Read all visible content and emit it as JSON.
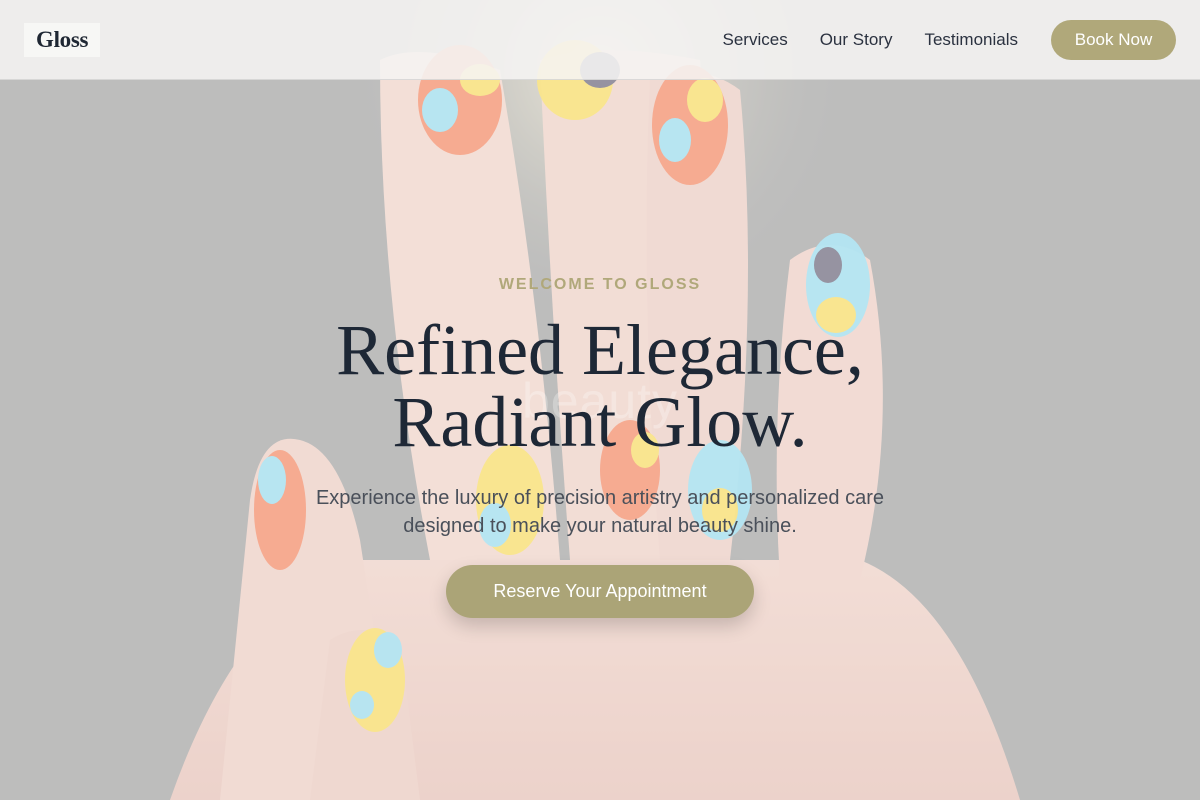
{
  "brand": {
    "name": "Gloss"
  },
  "nav": {
    "links": [
      {
        "label": "Services"
      },
      {
        "label": "Our Story"
      },
      {
        "label": "Testimonials"
      }
    ],
    "cta_label": "Book Now"
  },
  "hero": {
    "eyebrow": "WELCOME TO GLOSS",
    "headline_line1": "Refined Elegance,",
    "headline_line2": "Radiant Glow.",
    "background_watermark": "beauty",
    "subtext_line1": "Experience the luxury of precision artistry and personalized care",
    "subtext_line2": "designed to make your natural beauty shine.",
    "cta_label": "Reserve Your Appointment",
    "background_image": "hand-with-colorful-nail-art-photo"
  },
  "colors": {
    "accent": "#b0a87a",
    "heading": "#1e2836",
    "body_text": "#4a505a"
  }
}
